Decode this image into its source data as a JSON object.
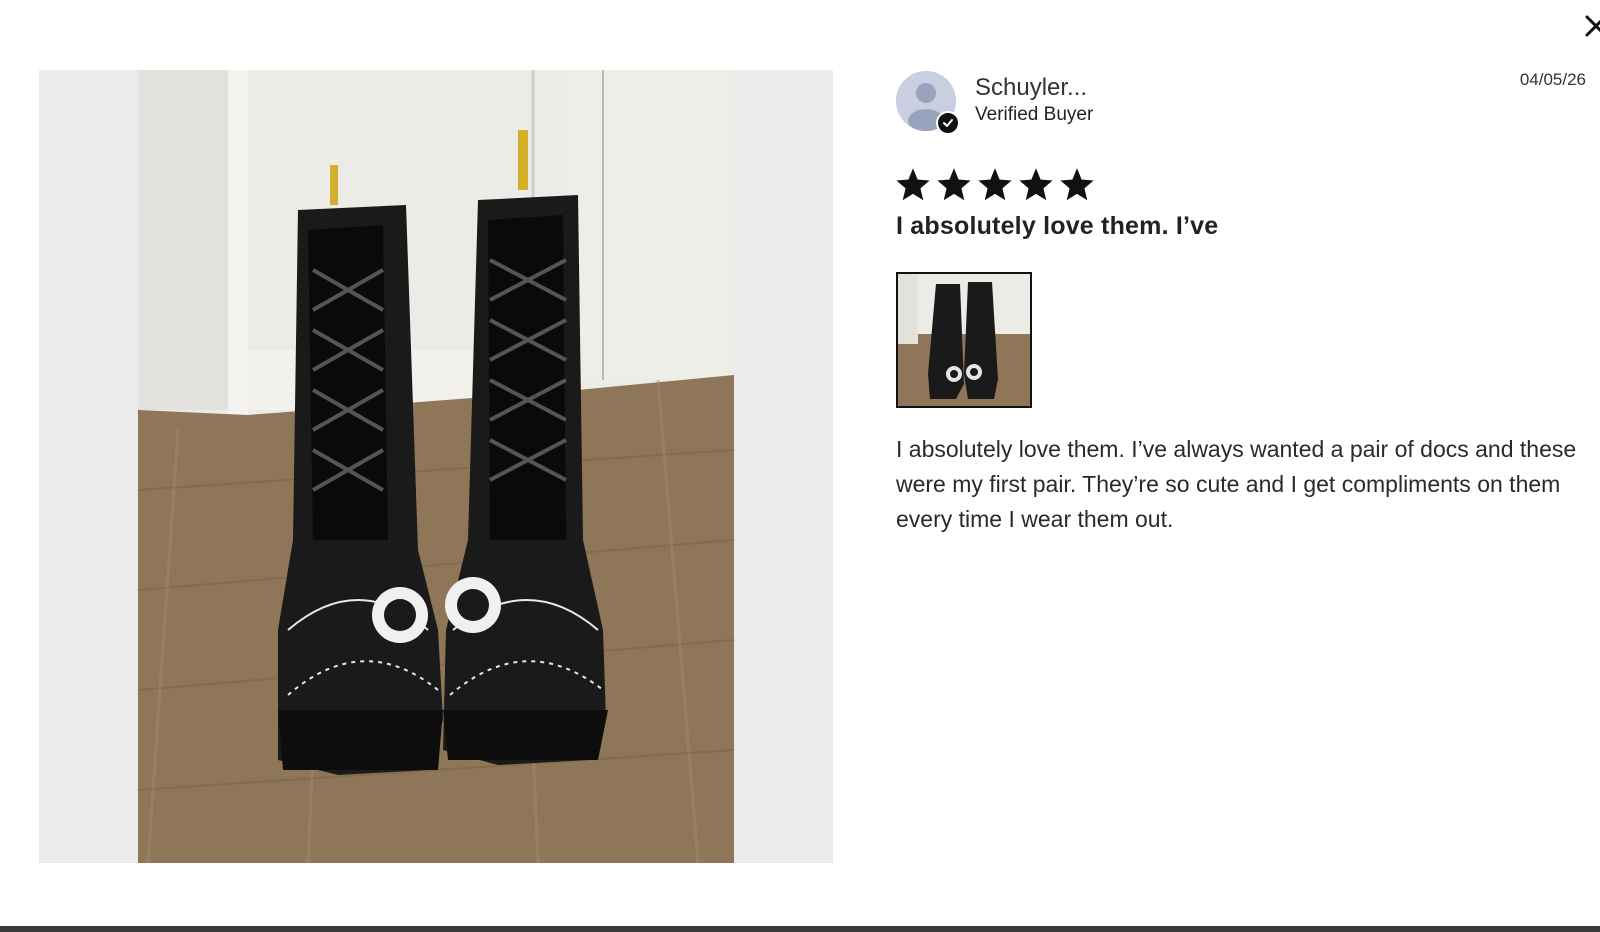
{
  "modal": {
    "close_icon": "close-icon"
  },
  "review": {
    "date": "04/05/26",
    "reviewer": {
      "name": "Schuyler...",
      "status": "Verified Buyer",
      "avatar_icon": "user-avatar-icon",
      "badge_icon": "checkmark-icon"
    },
    "rating": 5,
    "rating_max": 5,
    "title": "I absolutely love them. I’ve",
    "body": "I absolutely love them. I’ve always wanted a pair of docs and these were my first pair. They’re so cute and I get compliments on them every time I wear them out.",
    "photos_count": 1
  },
  "colors": {
    "media_background": "#ebebeb",
    "star": "#111111",
    "avatar_bg": "#c9cfe0"
  }
}
